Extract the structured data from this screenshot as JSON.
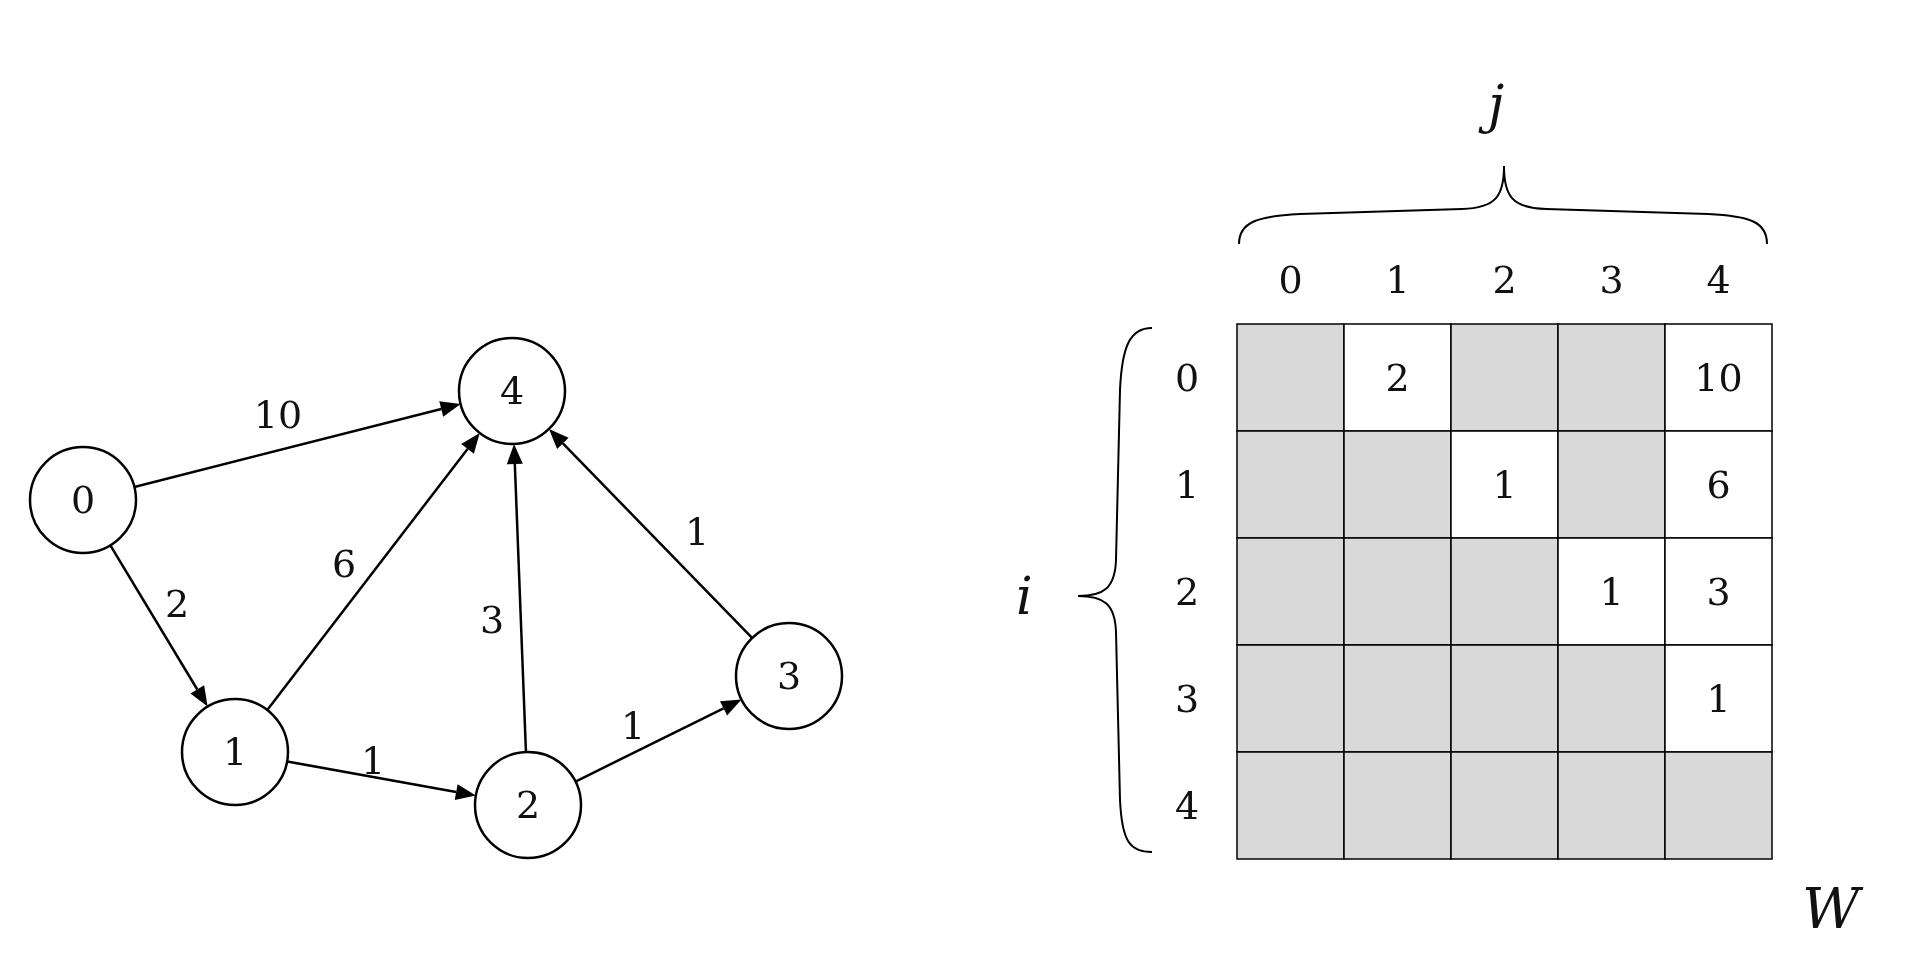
{
  "graph": {
    "nodes": [
      {
        "label": "0"
      },
      {
        "label": "1"
      },
      {
        "label": "2"
      },
      {
        "label": "3"
      },
      {
        "label": "4"
      }
    ],
    "edges": [
      {
        "weight": "10"
      },
      {
        "weight": "2"
      },
      {
        "weight": "6"
      },
      {
        "weight": "1"
      },
      {
        "weight": "3"
      },
      {
        "weight": "1"
      },
      {
        "weight": "1"
      }
    ]
  },
  "matrix": {
    "column_axis": "j",
    "row_axis": "i",
    "name": "W",
    "column_headers": [
      "0",
      "1",
      "2",
      "3",
      "4"
    ],
    "row_headers": [
      "0",
      "1",
      "2",
      "3",
      "4"
    ],
    "rows": [
      [
        {
          "shaded": true
        },
        {
          "shaded": false,
          "value": "2"
        },
        {
          "shaded": true
        },
        {
          "shaded": true
        },
        {
          "shaded": false,
          "value": "10"
        }
      ],
      [
        {
          "shaded": true
        },
        {
          "shaded": true
        },
        {
          "shaded": false,
          "value": "1"
        },
        {
          "shaded": true
        },
        {
          "shaded": false,
          "value": "6"
        }
      ],
      [
        {
          "shaded": true
        },
        {
          "shaded": true
        },
        {
          "shaded": true
        },
        {
          "shaded": false,
          "value": "1"
        },
        {
          "shaded": false,
          "value": "3"
        }
      ],
      [
        {
          "shaded": true
        },
        {
          "shaded": true
        },
        {
          "shaded": true
        },
        {
          "shaded": true
        },
        {
          "shaded": false,
          "value": "1"
        }
      ],
      [
        {
          "shaded": true
        },
        {
          "shaded": true
        },
        {
          "shaded": true
        },
        {
          "shaded": true
        },
        {
          "shaded": true
        }
      ]
    ]
  }
}
